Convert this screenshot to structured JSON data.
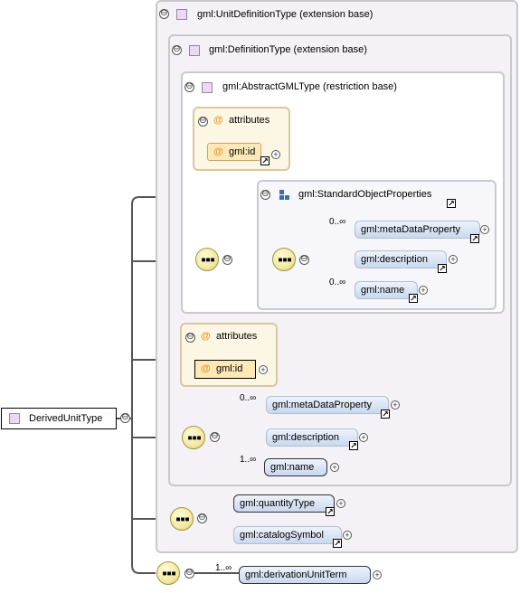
{
  "types": {
    "unit_definition": "gml:UnitDefinitionType (extension base)",
    "definition": "gml:DefinitionType (extension base)",
    "abstract_gml": "gml:AbstractGMLType (restriction base)"
  },
  "group": {
    "standard_object_properties": "gml:StandardObjectProperties"
  },
  "attributes": {
    "label": "attributes",
    "at_symbol": "@",
    "gml_id": "gml:id"
  },
  "elements": {
    "meta_data_property": "gml:metaDataProperty",
    "description": "gml:description",
    "name": "gml:name",
    "quantity_type": "gml:quantityType",
    "catalog_symbol": "gml:catalogSymbol",
    "derivation_unit_term": "gml:derivationUnitTerm"
  },
  "cardinality": {
    "zero_many": "0..∞",
    "one_many": "1..∞"
  },
  "root": {
    "label": "DerivedUnitType"
  },
  "symbols": {
    "collapse": "⊖",
    "expand": "+",
    "link": "↗"
  },
  "colors": {
    "type_border": "#c9c9c9",
    "element_fill": "#c9d8ef",
    "attribute_fill": "#fde9b8",
    "compositor_fill": "#f3e9a3"
  }
}
